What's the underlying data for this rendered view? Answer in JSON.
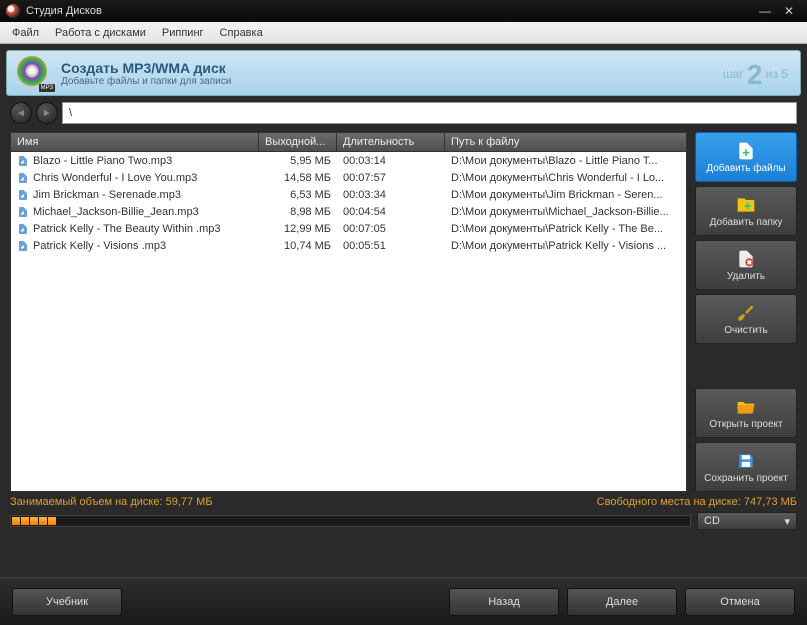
{
  "window": {
    "title": "Студия Дисков"
  },
  "menu": {
    "file": "Файл",
    "discs": "Работа с дисками",
    "ripping": "Риппинг",
    "help": "Справка"
  },
  "banner": {
    "title": "Создать MP3/WMA диск",
    "subtitle": "Добавьте файлы и папки для записи",
    "disc_tag": "MP3",
    "step_word": "шаг",
    "step_num": "2",
    "step_of": "из 5"
  },
  "path": {
    "value": "\\"
  },
  "columns": {
    "name": "Имя",
    "size": "Выходной...",
    "duration": "Длительность",
    "path": "Путь к файлу"
  },
  "files": [
    {
      "name": "Blazo - Little Piano Two.mp3",
      "size": "5,95 МБ",
      "duration": "00:03:14",
      "path": "D:\\Мои документы\\Blazo - Little Piano T..."
    },
    {
      "name": "Chris Wonderful - I Love You.mp3",
      "size": "14,58 МБ",
      "duration": "00:07:57",
      "path": "D:\\Мои документы\\Chris Wonderful - I Lo..."
    },
    {
      "name": "Jim Brickman - Serenade.mp3",
      "size": "6,53 МБ",
      "duration": "00:03:34",
      "path": "D:\\Мои документы\\Jim Brickman - Seren..."
    },
    {
      "name": "Michael_Jackson-Billie_Jean.mp3",
      "size": "8,98 МБ",
      "duration": "00:04:54",
      "path": "D:\\Мои документы\\Michael_Jackson-Billie..."
    },
    {
      "name": "Patrick Kelly - The Beauty Within .mp3",
      "size": "12,99 МБ",
      "duration": "00:07:05",
      "path": "D:\\Мои документы\\Patrick Kelly - The Be..."
    },
    {
      "name": "Patrick Kelly - Visions .mp3",
      "size": "10,74 МБ",
      "duration": "00:05:51",
      "path": "D:\\Мои документы\\Patrick Kelly - Visions ..."
    }
  ],
  "sidebar": {
    "add_files": "Добавить файлы",
    "add_folder": "Добавить папку",
    "delete": "Удалить",
    "clear": "Очистить",
    "open_project": "Открыть проект",
    "save_project": "Сохранить проект"
  },
  "status": {
    "used": "Занимаемый объем на диске: 59,77 МБ",
    "free": "Свободного места на диске: 747,73 МБ"
  },
  "disc_type": {
    "selected": "CD"
  },
  "footer": {
    "tutorial": "Учебник",
    "back": "Назад",
    "next": "Далее",
    "cancel": "Отмена"
  }
}
